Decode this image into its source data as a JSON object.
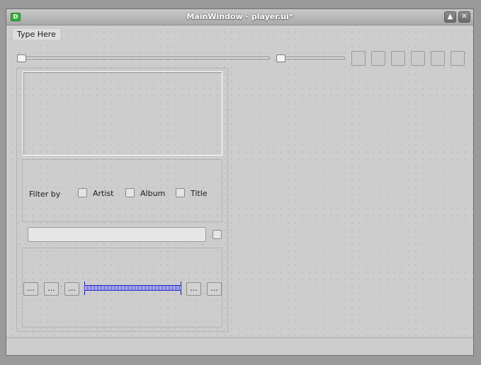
{
  "window": {
    "title": "MainWindow - player.ui*",
    "app_icon_letter": "D"
  },
  "titlebar_buttons": {
    "maximize_glyph": "▲",
    "close_glyph": "✕"
  },
  "menubar": {
    "placeholder": "Type Here"
  },
  "filter": {
    "label": "Filter by",
    "options": [
      "Artist",
      "Album",
      "Title"
    ]
  },
  "controls": {
    "button_text": "..."
  },
  "icons": {
    "app": "designer-app-icon",
    "maximize": "maximize-icon",
    "close": "close-icon"
  }
}
